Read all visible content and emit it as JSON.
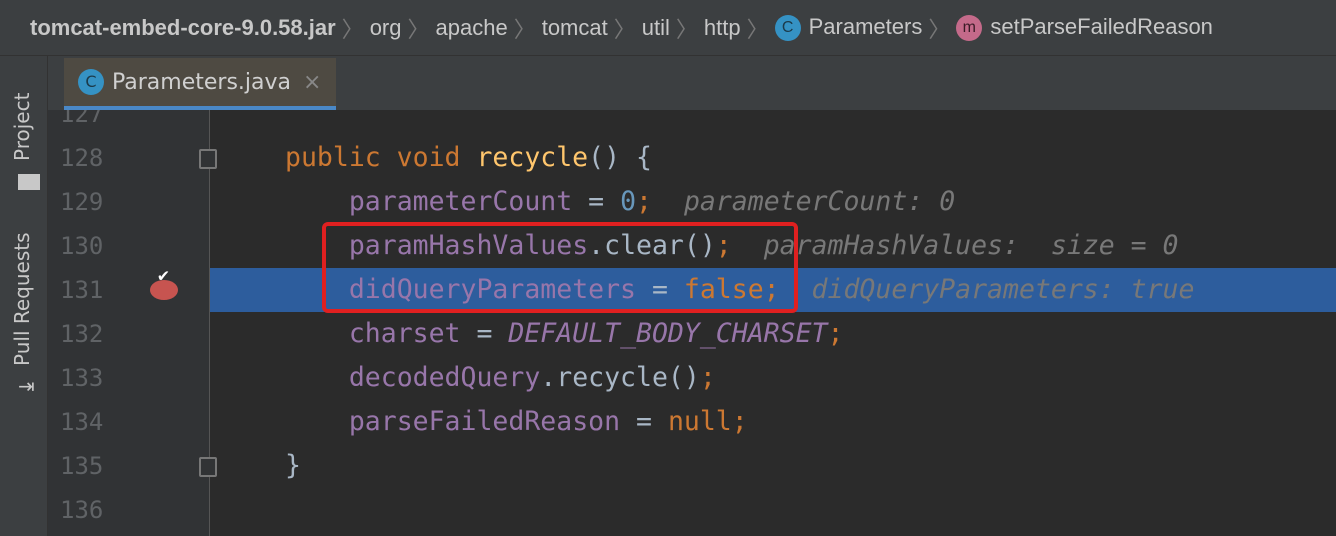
{
  "breadcrumb": [
    {
      "label": "tomcat-embed-core-9.0.58.jar"
    },
    {
      "label": "org"
    },
    {
      "label": "apache"
    },
    {
      "label": "tomcat"
    },
    {
      "label": "util"
    },
    {
      "label": "http"
    },
    {
      "label": "Parameters",
      "icon": "class-icon",
      "icon_letter": "C"
    },
    {
      "label": "setParseFailedReason",
      "icon": "method-icon",
      "icon_letter": "m"
    }
  ],
  "tool_strip": {
    "project": "Project",
    "pull_requests": "Pull Requests"
  },
  "tab": {
    "label": "Parameters.java",
    "icon_letter": "C",
    "close": "×"
  },
  "lines": [
    {
      "n": "127"
    },
    {
      "n": "128",
      "code": [
        [
          "kw",
          "public void "
        ],
        [
          "fn",
          "recycle"
        ],
        [
          "pl",
          "() {"
        ]
      ]
    },
    {
      "n": "129",
      "code": [
        [
          "pl",
          "    "
        ],
        [
          "fld",
          "parameterCount"
        ],
        [
          "pl",
          " = "
        ],
        [
          "num",
          "0"
        ],
        [
          "kw",
          ";"
        ]
      ],
      "hint": "parameterCount: 0"
    },
    {
      "n": "130",
      "code": [
        [
          "pl",
          "    "
        ],
        [
          "fld",
          "paramHashValues"
        ],
        [
          "pl",
          ".clear()"
        ],
        [
          "kw",
          ";"
        ]
      ],
      "hint": "paramHashValues:  size = 0"
    },
    {
      "n": "131",
      "code": [
        [
          "pl",
          "    "
        ],
        [
          "fld",
          "didQueryParameters"
        ],
        [
          "pl",
          " = "
        ],
        [
          "kw",
          "false;"
        ]
      ],
      "hint": "didQueryParameters: true",
      "current": true,
      "breakpoint": true
    },
    {
      "n": "132",
      "code": [
        [
          "pl",
          "    "
        ],
        [
          "fld",
          "charset"
        ],
        [
          "pl",
          " = "
        ],
        [
          "cst",
          "DEFAULT_BODY_CHARSET"
        ],
        [
          "kw",
          ";"
        ]
      ]
    },
    {
      "n": "133",
      "code": [
        [
          "pl",
          "    "
        ],
        [
          "fld",
          "decodedQuery"
        ],
        [
          "pl",
          ".recycle()"
        ],
        [
          "kw",
          ";"
        ]
      ]
    },
    {
      "n": "134",
      "code": [
        [
          "pl",
          "    "
        ],
        [
          "fld",
          "parseFailedReason"
        ],
        [
          "pl",
          " = "
        ],
        [
          "kw",
          "null;"
        ]
      ]
    },
    {
      "n": "135",
      "code": [
        [
          "pl",
          "}"
        ]
      ]
    },
    {
      "n": "136"
    }
  ],
  "colors": {
    "highlight": "#2d5d9d",
    "annotation_box": "#e02020",
    "breakpoint": "#c75450"
  }
}
